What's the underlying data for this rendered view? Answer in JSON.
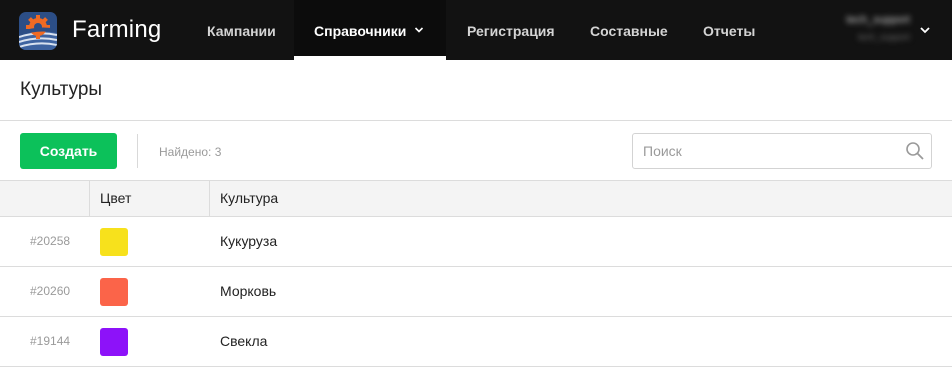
{
  "app": {
    "brand": "Farming"
  },
  "nav": {
    "items": [
      {
        "label": "Кампании"
      },
      {
        "label": "Справочники"
      },
      {
        "label": "Регистрация"
      },
      {
        "label": "Составные"
      },
      {
        "label": "Отчеты"
      }
    ],
    "active": "Справочники"
  },
  "user": {
    "name": "tech_support",
    "subtitle": "tech_support"
  },
  "page": {
    "title": "Культуры"
  },
  "toolbar": {
    "create_label": "Создать",
    "found_text": "Найдено: 3",
    "search_placeholder": "Поиск"
  },
  "table": {
    "columns": [
      "",
      "Цвет",
      "Культура"
    ],
    "rows": [
      {
        "id": "#20258",
        "color": "#f7e11c",
        "name": "Кукуруза"
      },
      {
        "id": "#20260",
        "color": "#fb6449",
        "name": "Морковь"
      },
      {
        "id": "#19144",
        "color": "#8d12f9",
        "name": "Свекла"
      }
    ]
  },
  "colors": {
    "topbar": "#121212",
    "accent_green": "#0cc15a",
    "logo_bg": "#2c4e86",
    "logo_gear": "#f06a23"
  },
  "icons": {
    "logo": "farming-logo-icon",
    "nav_dropdown": "chevron-down-icon",
    "user_menu": "chevron-down-icon",
    "search": "search-icon"
  }
}
